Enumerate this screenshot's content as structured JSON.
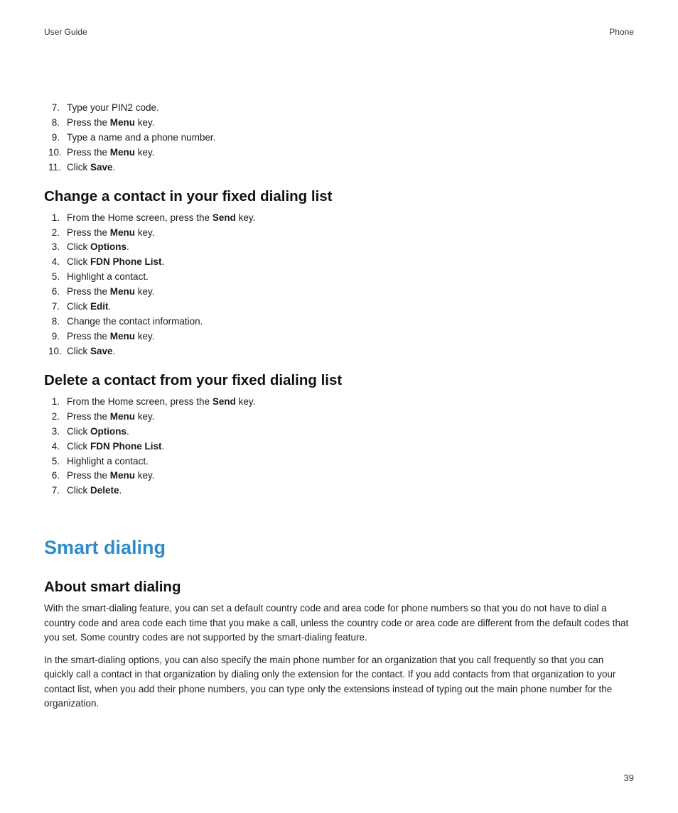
{
  "header": {
    "left": "User Guide",
    "right": "Phone"
  },
  "list1": {
    "start": 7,
    "items": [
      [
        {
          "t": "Type your PIN2 code."
        }
      ],
      [
        {
          "t": "Press the "
        },
        {
          "t": "Menu",
          "b": true
        },
        {
          "t": " key."
        }
      ],
      [
        {
          "t": "Type a name and a phone number."
        }
      ],
      [
        {
          "t": "Press the "
        },
        {
          "t": "Menu",
          "b": true
        },
        {
          "t": " key."
        }
      ],
      [
        {
          "t": "Click "
        },
        {
          "t": "Save",
          "b": true
        },
        {
          "t": "."
        }
      ]
    ]
  },
  "h2_1": "Change a contact in your fixed dialing list",
  "list2": {
    "start": 1,
    "items": [
      [
        {
          "t": "From the Home screen, press the "
        },
        {
          "t": "Send",
          "b": true
        },
        {
          "t": " key."
        }
      ],
      [
        {
          "t": "Press the "
        },
        {
          "t": "Menu",
          "b": true
        },
        {
          "t": " key."
        }
      ],
      [
        {
          "t": "Click "
        },
        {
          "t": "Options",
          "b": true
        },
        {
          "t": "."
        }
      ],
      [
        {
          "t": "Click "
        },
        {
          "t": "FDN Phone List",
          "b": true
        },
        {
          "t": "."
        }
      ],
      [
        {
          "t": "Highlight a contact."
        }
      ],
      [
        {
          "t": "Press the "
        },
        {
          "t": "Menu",
          "b": true
        },
        {
          "t": " key."
        }
      ],
      [
        {
          "t": "Click "
        },
        {
          "t": "Edit",
          "b": true
        },
        {
          "t": "."
        }
      ],
      [
        {
          "t": "Change the contact information."
        }
      ],
      [
        {
          "t": "Press the "
        },
        {
          "t": "Menu",
          "b": true
        },
        {
          "t": " key."
        }
      ],
      [
        {
          "t": "Click "
        },
        {
          "t": "Save",
          "b": true
        },
        {
          "t": "."
        }
      ]
    ]
  },
  "h2_2": "Delete a contact from your fixed dialing list",
  "list3": {
    "start": 1,
    "items": [
      [
        {
          "t": "From the Home screen, press the "
        },
        {
          "t": "Send",
          "b": true
        },
        {
          "t": " key."
        }
      ],
      [
        {
          "t": "Press the "
        },
        {
          "t": "Menu",
          "b": true
        },
        {
          "t": " key."
        }
      ],
      [
        {
          "t": "Click "
        },
        {
          "t": "Options",
          "b": true
        },
        {
          "t": "."
        }
      ],
      [
        {
          "t": "Click "
        },
        {
          "t": "FDN Phone List",
          "b": true
        },
        {
          "t": "."
        }
      ],
      [
        {
          "t": "Highlight a contact."
        }
      ],
      [
        {
          "t": "Press the "
        },
        {
          "t": "Menu",
          "b": true
        },
        {
          "t": " key."
        }
      ],
      [
        {
          "t": "Click "
        },
        {
          "t": "Delete",
          "b": true
        },
        {
          "t": "."
        }
      ]
    ]
  },
  "h1": "Smart dialing",
  "h2_3": "About smart dialing",
  "para1": "With the smart-dialing feature, you can set a default country code and area code for phone numbers so that you do not have to dial a country code and area code each time that you make a call, unless the country code or area code are different from the default codes that you set. Some country codes are not supported by the smart-dialing feature.",
  "para2": "In the smart-dialing options, you can also specify the main phone number for an organization that you call frequently so that you can quickly call a contact in that organization by dialing only the extension for the contact. If you add contacts from that organization to your contact list, when you add their phone numbers, you can type only the extensions instead of typing out the main phone number for the organization.",
  "page": "39"
}
